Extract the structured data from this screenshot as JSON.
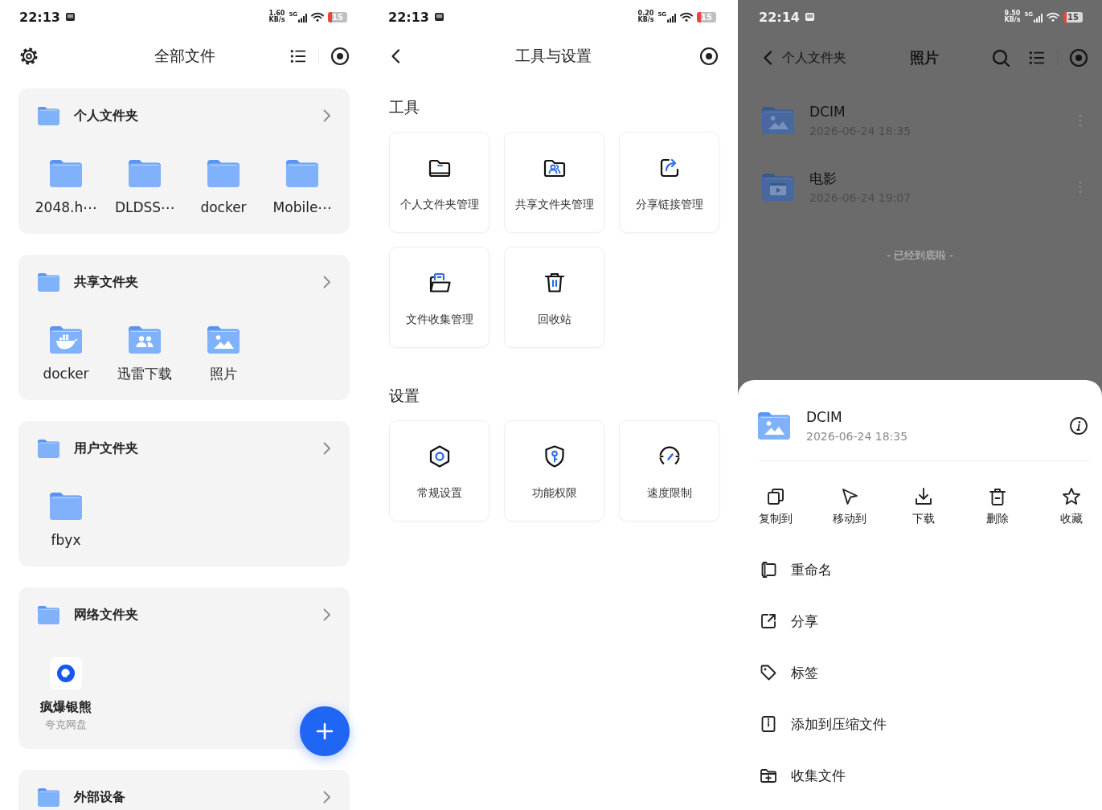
{
  "files_screen": {
    "status_bar": {
      "time": "22:13",
      "speed": "1.60",
      "speed_unit": "KB/s",
      "network": "5G",
      "battery": "15"
    },
    "title": "全部文件",
    "sections": [
      {
        "title": "个人文件夹",
        "items": [
          {
            "name": "2048.h⋯",
            "kind": "folder"
          },
          {
            "name": "DLDSS⋯",
            "kind": "folder"
          },
          {
            "name": "docker",
            "kind": "folder"
          },
          {
            "name": "Mobile⋯",
            "kind": "folder"
          }
        ]
      },
      {
        "title": "共享文件夹",
        "items": [
          {
            "name": "docker",
            "kind": "docker"
          },
          {
            "name": "迅雷下载",
            "kind": "shared"
          },
          {
            "name": "照片",
            "kind": "photos"
          }
        ]
      },
      {
        "title": "用户文件夹",
        "items": [
          {
            "name": "fbyx",
            "kind": "folder"
          }
        ]
      },
      {
        "title": "网络文件夹",
        "items": [
          {
            "name": "疯爆银熊",
            "kind": "drive",
            "subtitle": "夸克网盘"
          }
        ]
      },
      {
        "title": "外部设备"
      }
    ]
  },
  "tools_screen": {
    "status_bar": {
      "time": "22:13",
      "speed": "0.20",
      "speed_unit": "KB/s",
      "network": "5G",
      "battery": "15"
    },
    "title": "工具与设置",
    "groups": [
      {
        "heading": "工具",
        "tiles": [
          {
            "label": "个人文件夹管理",
            "kind": "personal"
          },
          {
            "label": "共享文件夹管理",
            "kind": "shared"
          },
          {
            "label": "分享链接管理",
            "kind": "links"
          },
          {
            "label": "文件收集管理",
            "kind": "collect"
          },
          {
            "label": "回收站",
            "kind": "trash"
          }
        ]
      },
      {
        "heading": "设置",
        "tiles": [
          {
            "label": "常规设置",
            "kind": "general"
          },
          {
            "label": "功能权限",
            "kind": "permissions"
          },
          {
            "label": "速度限制",
            "kind": "speed"
          }
        ]
      }
    ]
  },
  "folder_screen": {
    "status_bar": {
      "time": "22:14",
      "speed": "9.50",
      "speed_unit": "KB/s",
      "network": "5G",
      "battery": "15"
    },
    "back_label": "个人文件夹",
    "title": "照片",
    "files": [
      {
        "name": "DCIM",
        "date": "2026-06-24 18:35",
        "kind": "photos"
      },
      {
        "name": "电影",
        "date": "2026-06-24 19:07",
        "kind": "videos"
      }
    ],
    "end_note": "- 已经到底啦 -",
    "sheet": {
      "name": "DCIM",
      "date": "2026-06-24 18:35",
      "kind": "photos",
      "actions": [
        {
          "label": "复制到",
          "kind": "copy"
        },
        {
          "label": "移动到",
          "kind": "move"
        },
        {
          "label": "下载",
          "kind": "download"
        },
        {
          "label": "删除",
          "kind": "delete"
        },
        {
          "label": "收藏",
          "kind": "favorite"
        }
      ],
      "menu": [
        {
          "label": "重命名",
          "kind": "rename"
        },
        {
          "label": "分享",
          "kind": "share"
        },
        {
          "label": "标签",
          "kind": "tag"
        },
        {
          "label": "添加到压缩文件",
          "kind": "archive"
        },
        {
          "label": "收集文件",
          "kind": "collect"
        }
      ]
    }
  }
}
